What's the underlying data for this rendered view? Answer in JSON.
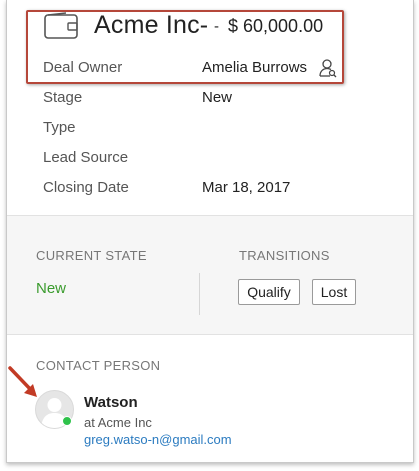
{
  "deal": {
    "icon": "wallet-icon",
    "name": "Acme Inc-",
    "separator": "-",
    "amount": "$ 60,000.00"
  },
  "fields": {
    "owner": {
      "label": "Deal Owner",
      "value": "Amelia Burrows",
      "icon": "user-search-icon"
    },
    "stage": {
      "label": "Stage",
      "value": "New"
    },
    "type": {
      "label": "Type",
      "value": ""
    },
    "lead_source": {
      "label": "Lead Source",
      "value": ""
    },
    "closing_date": {
      "label": "Closing Date",
      "value": "Mar 18, 2017"
    }
  },
  "state": {
    "current_title": "CURRENT STATE",
    "current_value": "New",
    "transitions_title": "TRANSITIONS",
    "buttons": {
      "qualify": "Qualify",
      "lost": "Lost"
    }
  },
  "contact": {
    "title": "CONTACT PERSON",
    "name": "Watson",
    "company": "at Acme Inc",
    "email": "greg.watso-n@gmail.com",
    "status": "online"
  },
  "colors": {
    "accent_green": "#3a9b2d",
    "link_blue": "#2b7bc0",
    "highlight_red": "#b5473a",
    "online_dot": "#2fc24b"
  }
}
